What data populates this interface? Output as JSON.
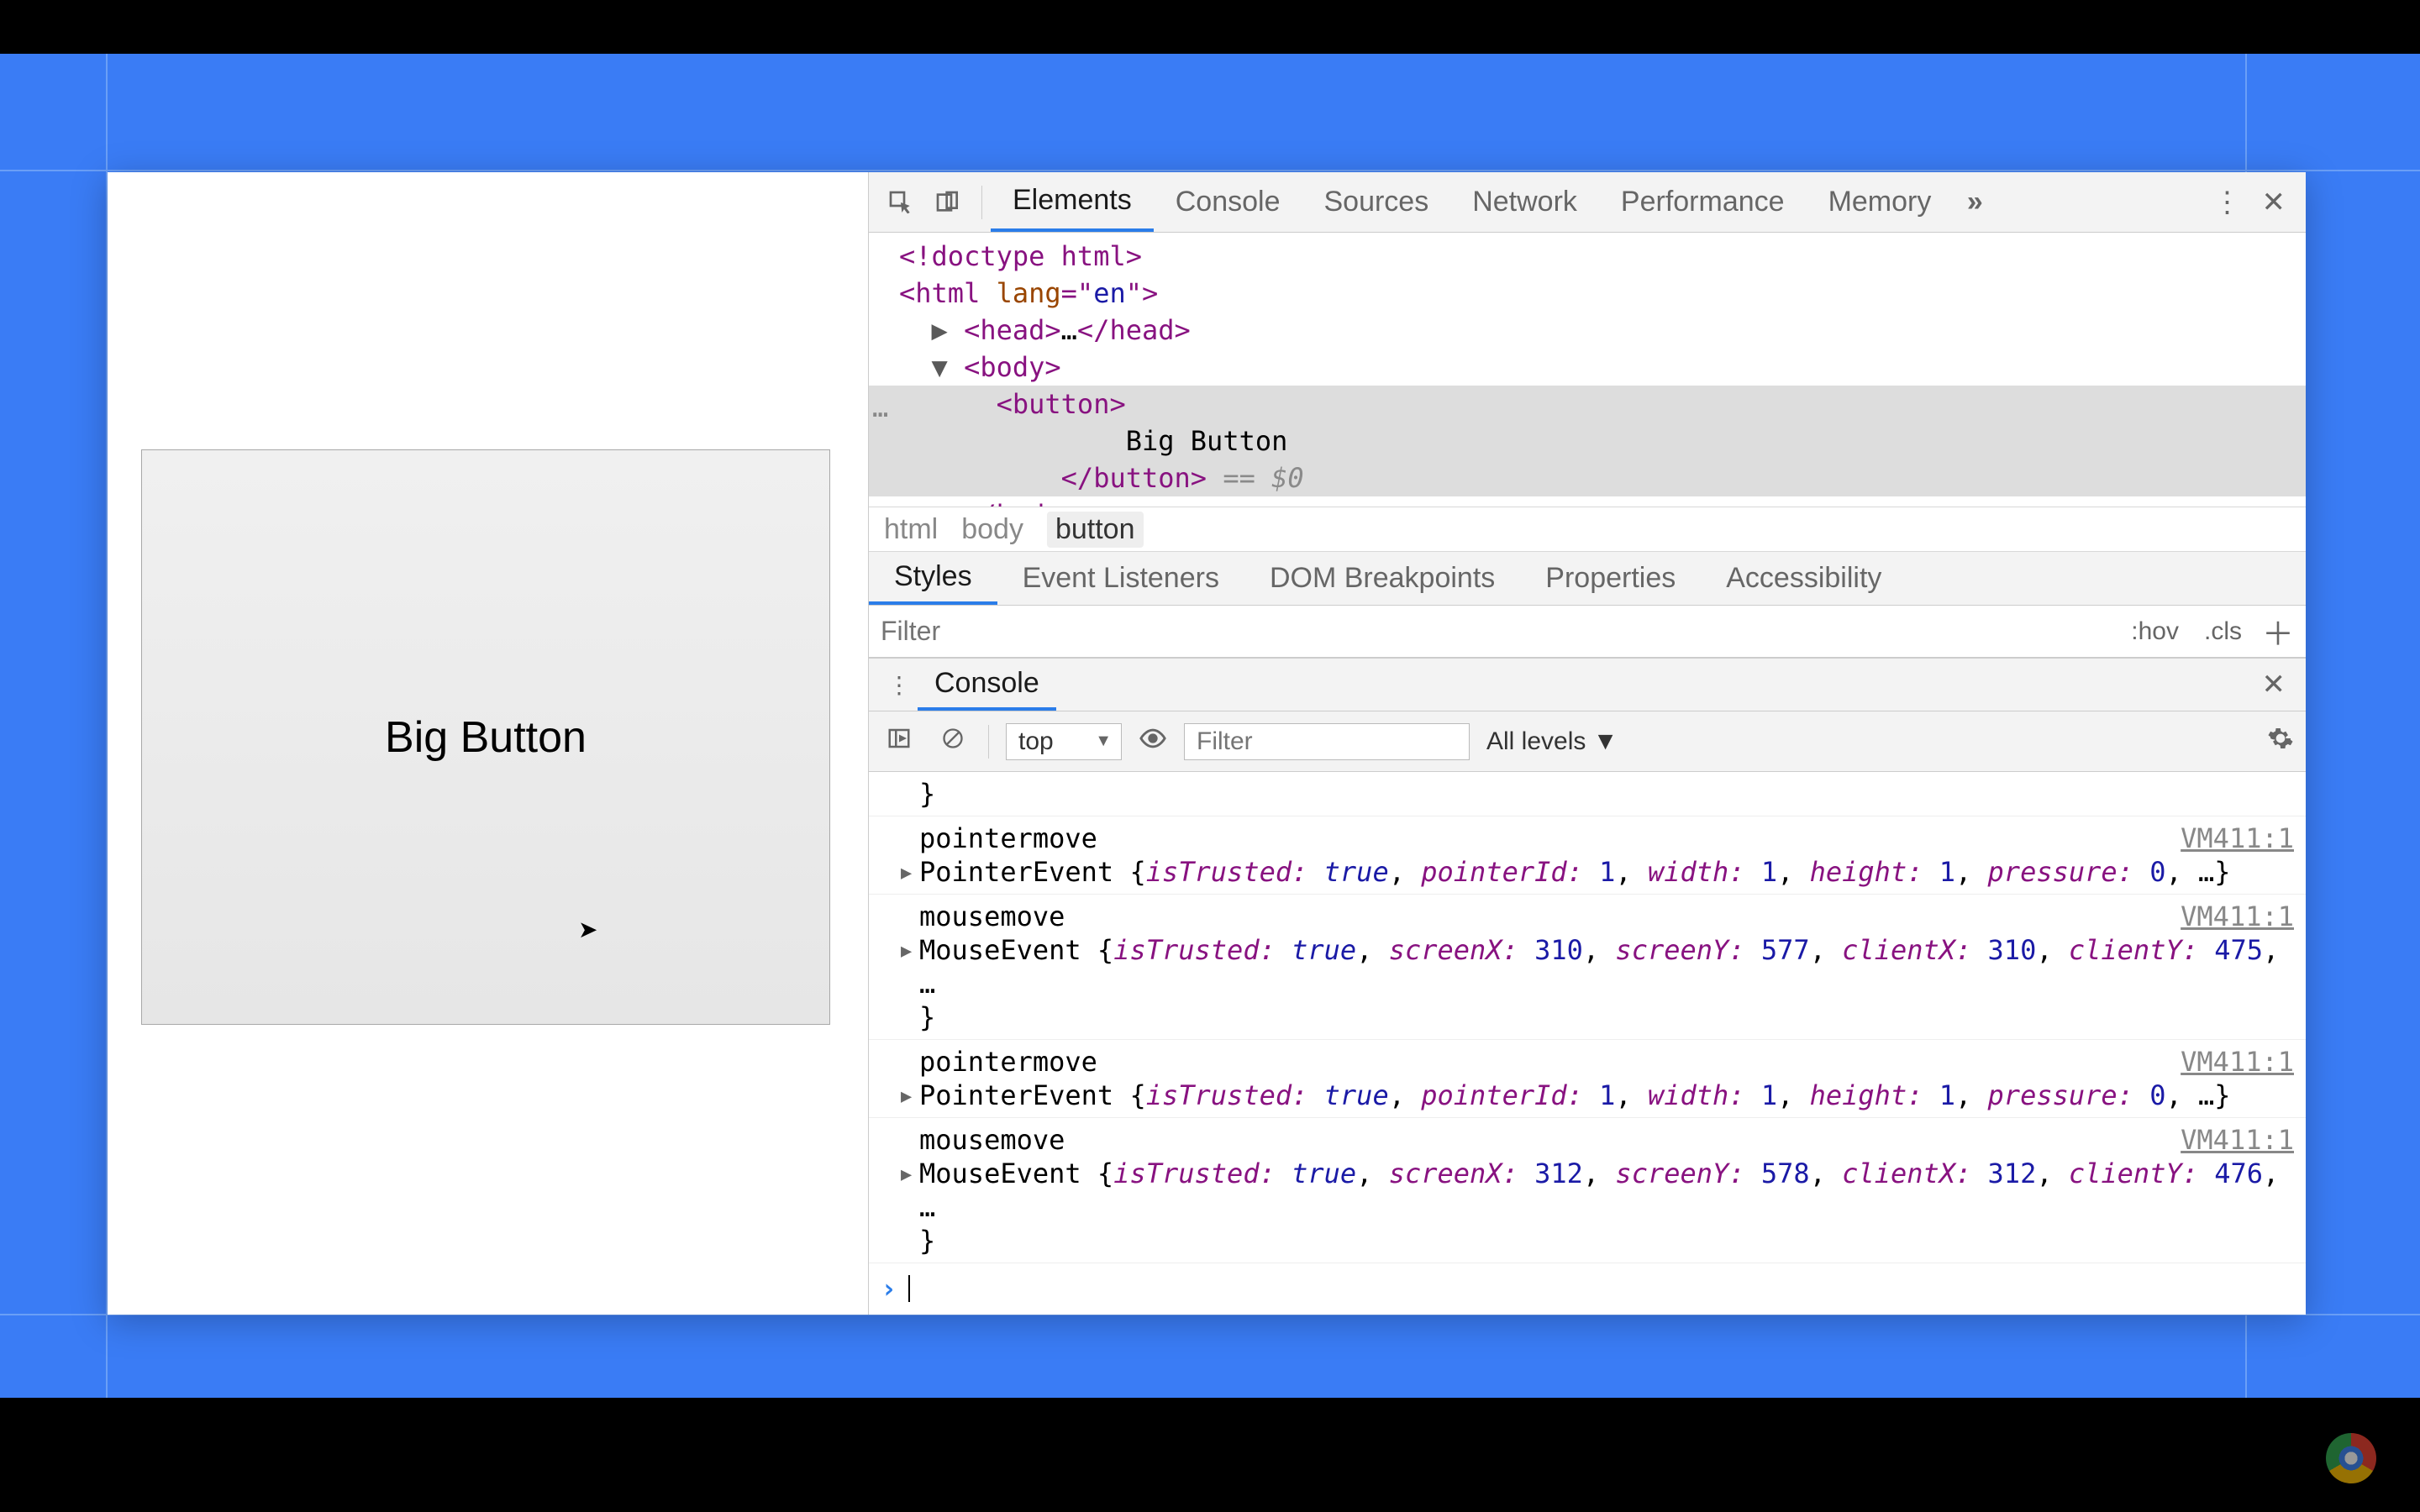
{
  "page": {
    "button_label": "Big Button"
  },
  "devtools": {
    "tabs": [
      "Elements",
      "Console",
      "Sources",
      "Network",
      "Performance",
      "Memory"
    ],
    "active_tab": "Elements",
    "dom": {
      "l0": "<!doctype html>",
      "l1a": "<html ",
      "l1b": "lang",
      "l1c": "=\"",
      "l1d": "en",
      "l1e": "\">",
      "l2a": "<head>",
      "l2b": "…",
      "l2c": "</head>",
      "l3": "<body>",
      "l4": "<button>",
      "l5": "Big Button",
      "l6a": "</button>",
      "l6b": " == $0",
      "l7": "</body>"
    },
    "breadcrumb": [
      "html",
      "body",
      "button"
    ],
    "subtabs": [
      "Styles",
      "Event Listeners",
      "DOM Breakpoints",
      "Properties",
      "Accessibility"
    ],
    "active_subtab": "Styles",
    "styles": {
      "filter_placeholder": "Filter",
      "hov": ":hov",
      "cls": ".cls"
    },
    "console": {
      "title": "Console",
      "context": "top",
      "filter_placeholder": "Filter",
      "levels": "All levels ▼",
      "log": [
        {
          "trailing_brace": "}"
        },
        {
          "name": "pointermove",
          "src": "VM411:1",
          "cls": "PointerEvent",
          "body": "{isTrusted: true, pointerId: 1, width: 1, height: 1, pressure: 0, …}",
          "props": [
            [
              "isTrusted",
              "true",
              "bool"
            ],
            [
              "pointerId",
              "1",
              "num"
            ],
            [
              "width",
              "1",
              "num"
            ],
            [
              "height",
              "1",
              "num"
            ],
            [
              "pressure",
              "0",
              "num"
            ]
          ]
        },
        {
          "name": "mousemove",
          "src": "VM411:1",
          "cls": "MouseEvent",
          "trail_brace": true,
          "props": [
            [
              "isTrusted",
              "true",
              "bool"
            ],
            [
              "screenX",
              "310",
              "num"
            ],
            [
              "screenY",
              "577",
              "num"
            ],
            [
              "clientX",
              "310",
              "num"
            ],
            [
              "clientY",
              "475",
              "num"
            ]
          ]
        },
        {
          "name": "pointermove",
          "src": "VM411:1",
          "cls": "PointerEvent",
          "props": [
            [
              "isTrusted",
              "true",
              "bool"
            ],
            [
              "pointerId",
              "1",
              "num"
            ],
            [
              "width",
              "1",
              "num"
            ],
            [
              "height",
              "1",
              "num"
            ],
            [
              "pressure",
              "0",
              "num"
            ]
          ]
        },
        {
          "name": "mousemove",
          "src": "VM411:1",
          "cls": "MouseEvent",
          "trail_brace": true,
          "props": [
            [
              "isTrusted",
              "true",
              "bool"
            ],
            [
              "screenX",
              "312",
              "num"
            ],
            [
              "screenY",
              "578",
              "num"
            ],
            [
              "clientX",
              "312",
              "num"
            ],
            [
              "clientY",
              "476",
              "num"
            ]
          ]
        }
      ]
    }
  }
}
